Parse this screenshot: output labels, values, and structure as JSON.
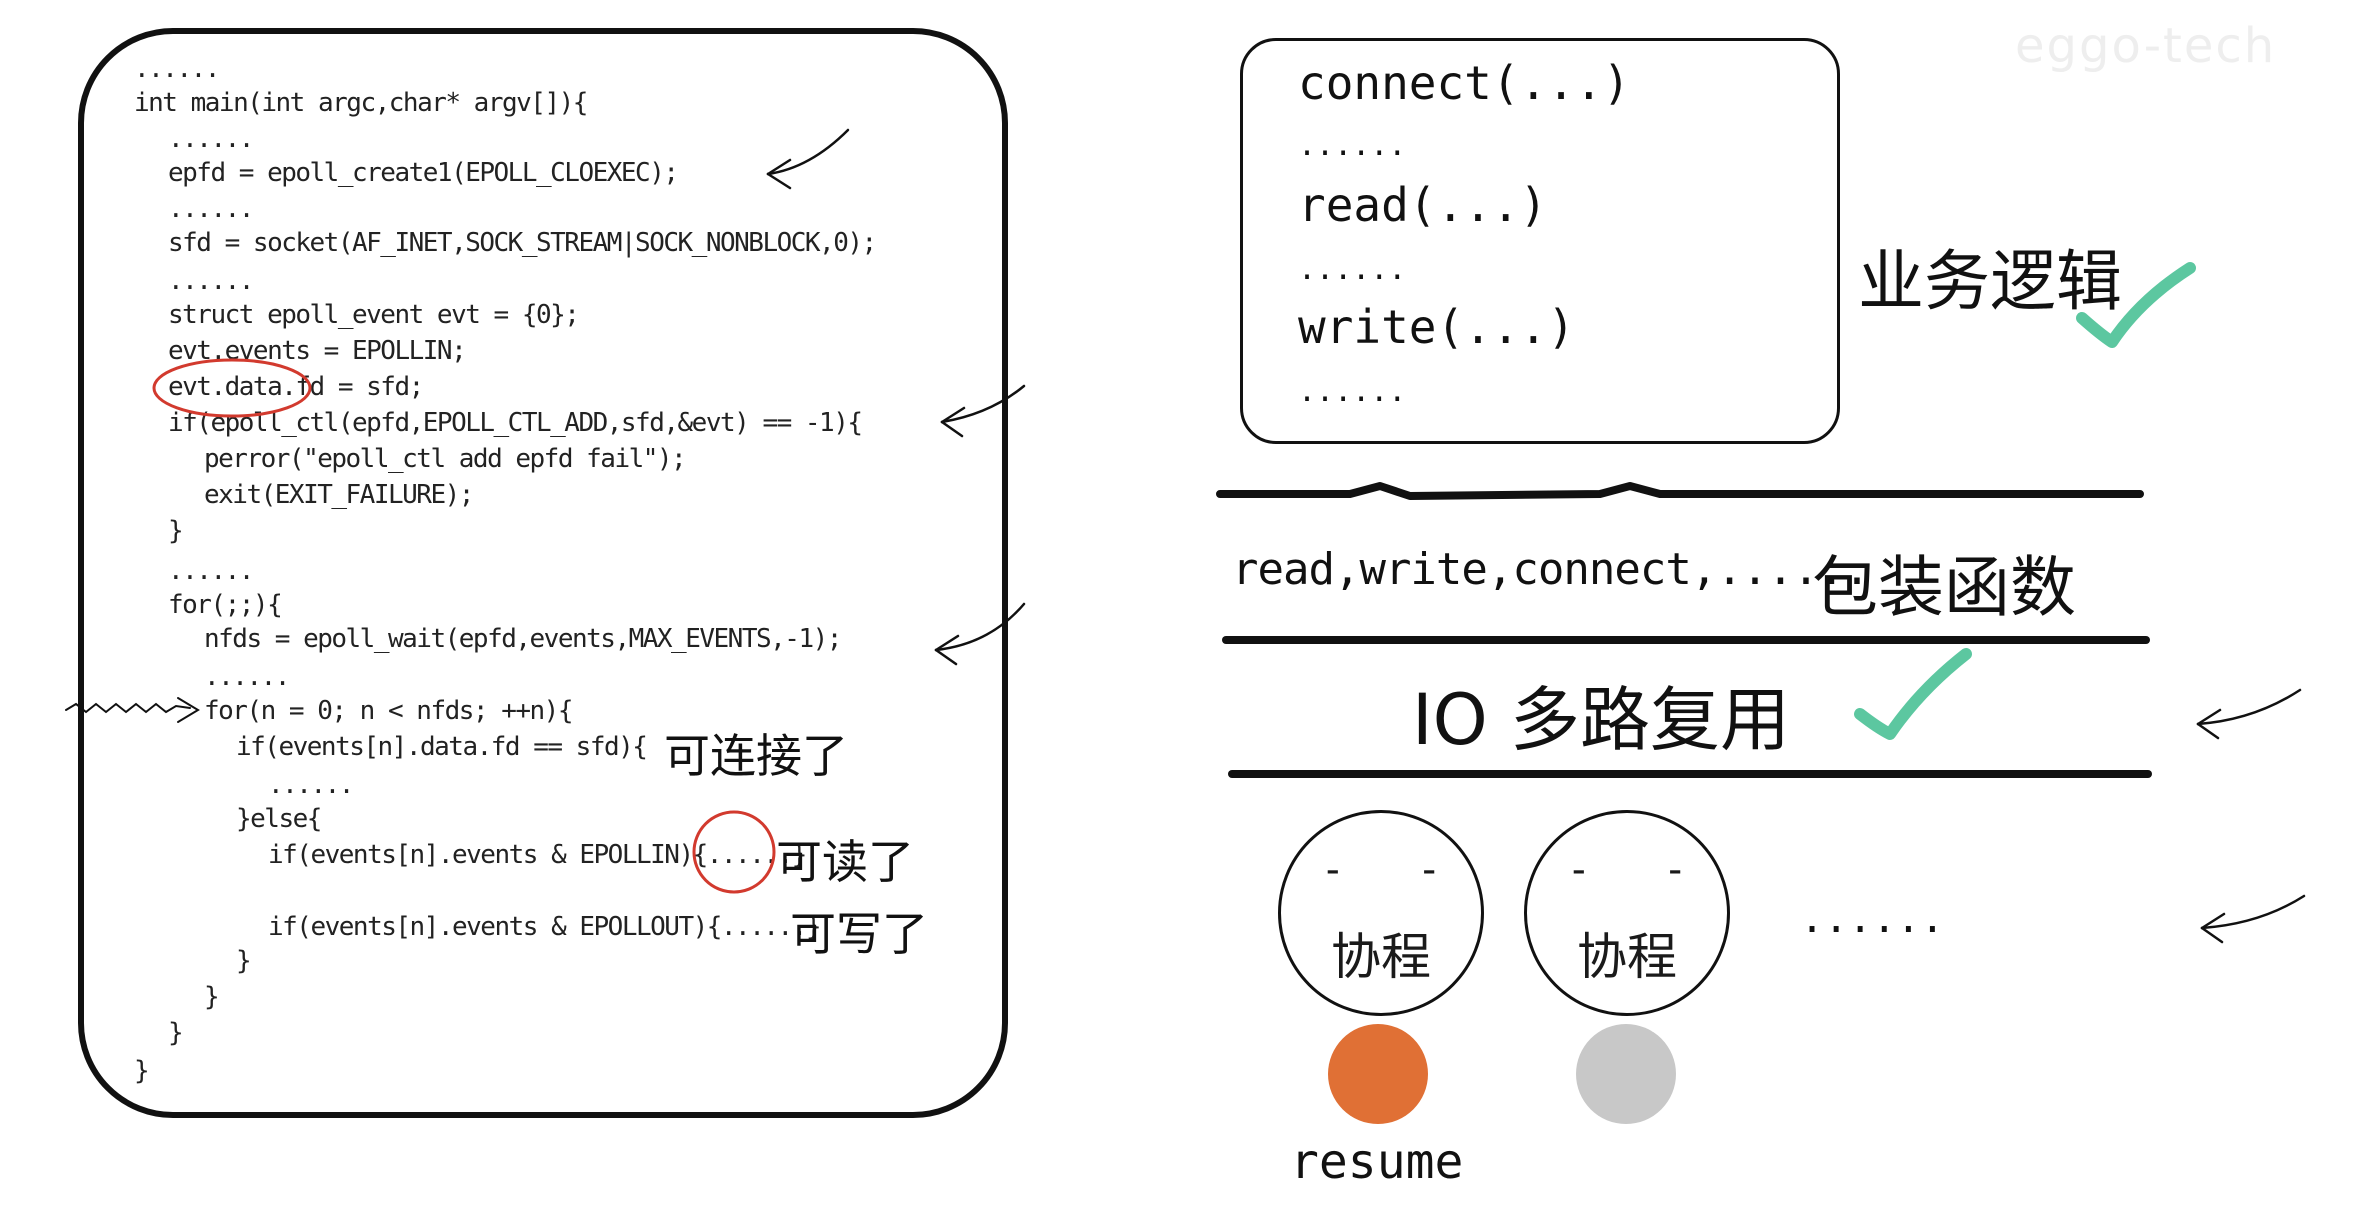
{
  "watermark": "eggo-tech",
  "code": {
    "lines": [
      "......",
      "int main(int argc,char* argv[]){",
      "......",
      "epfd = epoll_create1(EPOLL_CLOEXEC);",
      "......",
      "sfd = socket(AF_INET,SOCK_STREAM|SOCK_NONBLOCK,0);",
      "......",
      "struct epoll_event evt = {0};",
      "evt.events = EPOLLIN;",
      "evt.data.fd = sfd;",
      "if(epoll_ctl(epfd,EPOLL_CTL_ADD,sfd,&evt) == -1){",
      "perror(\"epoll_ctl add epfd fail\");",
      "exit(EXIT_FAILURE);",
      "}",
      "......",
      "for(;;){",
      "nfds = epoll_wait(epfd,events,MAX_EVENTS,-1);",
      "......",
      "for(n = 0; n < nfds; ++n){",
      "if(events[n].data.fd == sfd){",
      "......",
      "}else{",
      "if(events[n].events & EPOLLIN){......}",
      "if(events[n].events & EPOLLOUT){......}",
      "}",
      "}",
      "}",
      "}"
    ],
    "notes": {
      "connectable": "可连接了",
      "readable": "可读了",
      "writable": "可写了"
    }
  },
  "business_box": {
    "lines": [
      "connect(...)",
      "......",
      "read(...)",
      "......",
      "write(...)",
      "......"
    ],
    "label": "业务逻辑"
  },
  "wrapper_layer": {
    "functions": "read,write,connect,......",
    "label": "包装函数"
  },
  "io_layer": {
    "label": "IO 多路复用"
  },
  "coroutines": {
    "items": [
      {
        "eyes": "-   -",
        "label": "协程",
        "state_color": "#e07035",
        "state_label": "resume"
      },
      {
        "eyes": "-   -",
        "label": "协程",
        "state_color": "#c8c8c8"
      }
    ],
    "more": "......"
  },
  "colors": {
    "check": "#5cc7a0",
    "circle": "#d23a2e",
    "ink": "#111111"
  },
  "icons": [
    "arrow-icon",
    "check-icon",
    "wavy-arrow-icon",
    "highlight-circle"
  ]
}
